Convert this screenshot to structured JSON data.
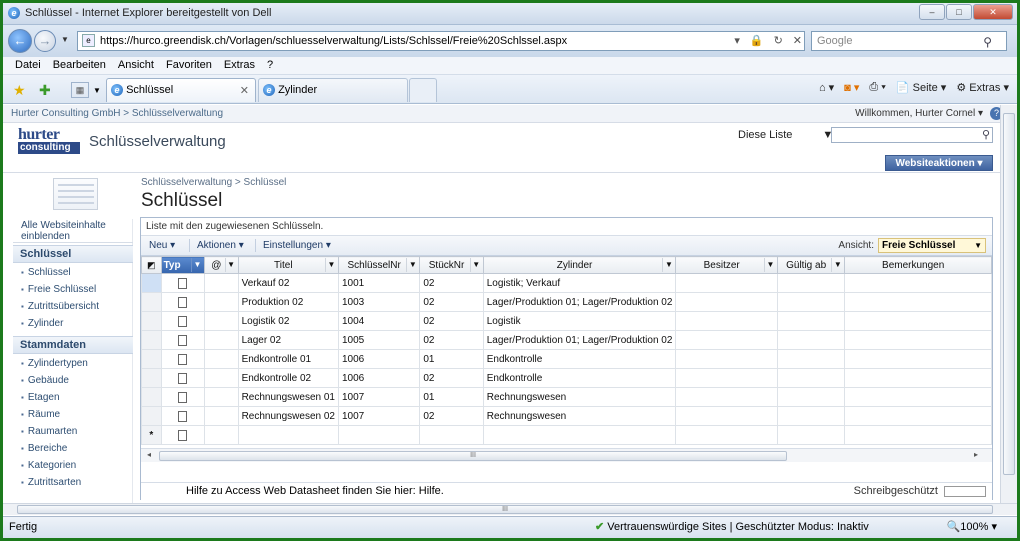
{
  "window": {
    "title": "Schlüssel - Internet Explorer bereitgestellt von Dell"
  },
  "address": {
    "url": "https://hurco.greendisk.ch/Vorlagen/schluesselverwaltung/Lists/Schlssel/Freie%20Schlssel.aspx",
    "search_placeholder": "Google"
  },
  "menu": [
    "Datei",
    "Bearbeiten",
    "Ansicht",
    "Favoriten",
    "Extras",
    "?"
  ],
  "tabs": [
    {
      "label": "Schlüssel"
    },
    {
      "label": "Zylinder"
    }
  ],
  "commandbar": {
    "page": "Seite",
    "tools": "Extras"
  },
  "sharepoint": {
    "breadcrumb": "Hurter Consulting GmbH > Schlüsselverwaltung",
    "welcome": "Willkommen, Hurter Cornel",
    "help": "?",
    "logo_top": "hurter",
    "logo_bottom": "consulting",
    "site_title": "Schlüsselverwaltung",
    "search_scope": "Diese Liste",
    "site_actions": "Websiteaktionen"
  },
  "page": {
    "breadcrumb": "Schlüsselverwaltung > Schlüssel",
    "title": "Schlüssel"
  },
  "leftnav": {
    "view_all": "Alle Websiteinhalte einblenden",
    "sections": [
      {
        "heading": "Schlüssel",
        "items": [
          "Schlüssel",
          "Freie Schlüssel",
          "Zutrittsübersicht",
          "Zylinder"
        ]
      },
      {
        "heading": "Stammdaten",
        "items": [
          "Zylindertypen",
          "Gebäude",
          "Etagen",
          "Räume",
          "Raumarten",
          "Bereiche",
          "Kategorien",
          "Zutrittsarten"
        ]
      }
    ]
  },
  "list": {
    "description": "Liste mit den zugewiesenen Schlüsseln.",
    "toolbar": {
      "new": "Neu",
      "actions": "Aktionen",
      "settings": "Einstellungen",
      "view_label": "Ansicht:",
      "view_value": "Freie Schlüssel"
    },
    "columns": [
      "Typ",
      "@",
      "Titel",
      "SchlüsselNr",
      "StückNr",
      "Zylinder",
      "Besitzer",
      "Gültig ab",
      "Bemerkungen"
    ],
    "rows": [
      {
        "titel": "Verkauf 02",
        "nr": "1001",
        "stueck": "02",
        "zylinder": "Logistik; Verkauf"
      },
      {
        "titel": "Produktion 02",
        "nr": "1003",
        "stueck": "02",
        "zylinder": "Lager/Produktion 01; Lager/Produktion 02"
      },
      {
        "titel": "Logistik 02",
        "nr": "1004",
        "stueck": "02",
        "zylinder": "Logistik"
      },
      {
        "titel": "Lager 02",
        "nr": "1005",
        "stueck": "02",
        "zylinder": "Lager/Produktion 01; Lager/Produktion 02"
      },
      {
        "titel": "Endkontrolle 01",
        "nr": "1006",
        "stueck": "01",
        "zylinder": "Endkontrolle"
      },
      {
        "titel": "Endkontrolle 02",
        "nr": "1006",
        "stueck": "02",
        "zylinder": "Endkontrolle"
      },
      {
        "titel": "Rechnungswesen 01",
        "nr": "1007",
        "stueck": "01",
        "zylinder": "Rechnungswesen"
      },
      {
        "titel": "Rechnungswesen 02",
        "nr": "1007",
        "stueck": "02",
        "zylinder": "Rechnungswesen"
      }
    ],
    "new_row_marker": "*",
    "help_text": "Hilfe zu Access Web Datasheet finden Sie hier: Hilfe.",
    "readonly": "Schreibgeschützt"
  },
  "statusbar": {
    "done": "Fertig",
    "trust": "Vertrauenswürdige Sites | Geschützter Modus: Inaktiv",
    "zoom": "100%"
  },
  "colors": {
    "frame": "#1c7a1c",
    "header_blue": "#3665ad",
    "site_actions": "#4f72ad"
  }
}
